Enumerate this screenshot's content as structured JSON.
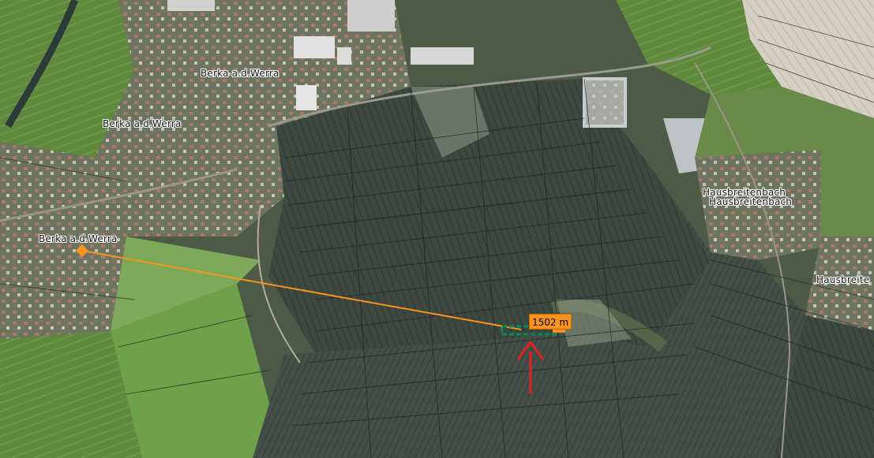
{
  "map": {
    "place_labels": {
      "berka_1": "Berka a.d.Werra",
      "berka_2": "Berka a.d.Werra",
      "berka_3": "Berka a.d.Werra",
      "hausbreitenbach_1": "Hausbreitenbach",
      "hausbreitenbach_2": "Hausbreitenbach",
      "hausbreitenbach_3": "Hausbreite"
    },
    "measurement": {
      "distance_label": "1502 m",
      "line_color": "#f7931e",
      "arrow_color": "#e0201b",
      "marker_color": "#0a8a5a"
    }
  }
}
